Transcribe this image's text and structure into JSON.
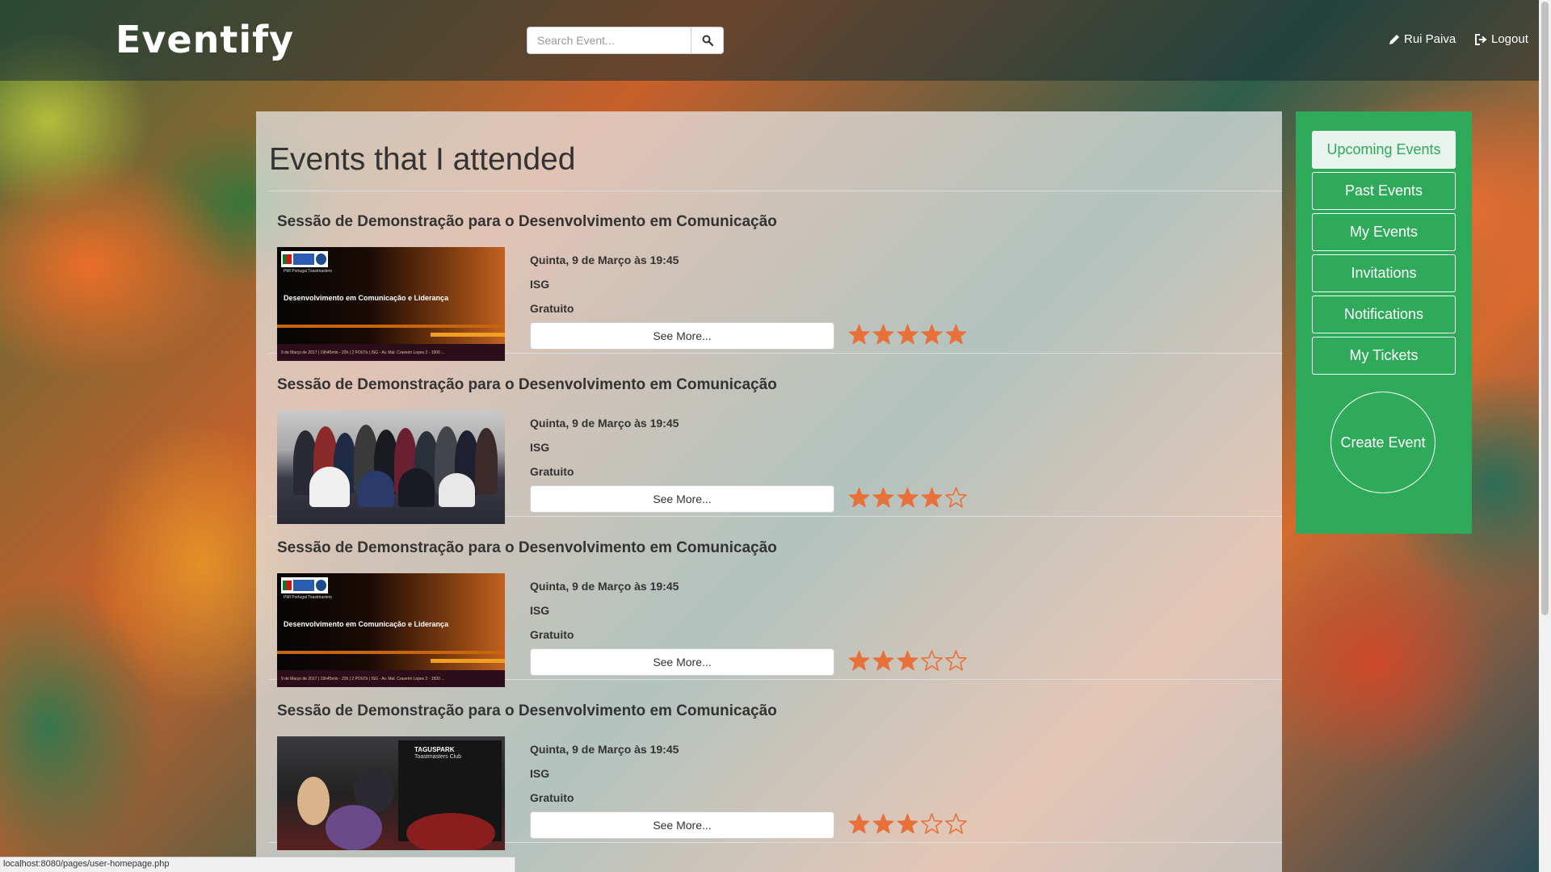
{
  "navbar": {
    "brand": "Eventify",
    "search_placeholder": "Search Event...",
    "user_label": "Rui Paiva",
    "logout_label": "Logout"
  },
  "main": {
    "title": "Events that I attended",
    "events": [
      {
        "title": "Sessão de Demonstração para o Desenvolvimento em Comunicação",
        "date": "Quinta, 9 de Março às 19:45",
        "place": "ISG",
        "price": "Gratuito",
        "see_more_label": "See More...",
        "rating": 5,
        "image": {
          "sub": "PMI Portugal Toastmasters",
          "headline": "Desenvolvimento em Comunicação e Liderança",
          "footer": "9 de Março de 2017 | 19h45min - 22h | 2 POUTs | ISG - Av. Mal. Craveiro Lopes 2 - 1500 ..."
        }
      },
      {
        "title": "Sessão de Demonstração para o Desenvolvimento em Comunicação",
        "date": "Quinta, 9 de Março às 19:45",
        "place": "ISG",
        "price": "Gratuito",
        "see_more_label": "See More...",
        "rating": 4
      },
      {
        "title": "Sessão de Demonstração para o Desenvolvimento em Comunicação",
        "date": "Quinta, 9 de Março às 19:45",
        "place": "ISG",
        "price": "Gratuito",
        "see_more_label": "See More...",
        "rating": 3,
        "image": {
          "sub": "PMI Portugal Toastmasters",
          "headline": "Desenvolvimento em Comunicação e Liderança",
          "footer": "9 de Março de 2017 | 19h45min - 22h | 2 POUTs | ISG - Av. Mal. Craveiro Lopes 2 - 1500 ..."
        }
      },
      {
        "title": "Sessão de Demonstração para o Desenvolvimento em Comunicação",
        "date": "Quinta, 9 de Março às 19:45",
        "place": "ISG",
        "price": "Gratuito",
        "see_more_label": "See More...",
        "rating": 3,
        "image": {
          "title": "TAGUSPARK",
          "sub": "Toastmasters Club"
        }
      }
    ]
  },
  "sidebar": {
    "items": [
      {
        "label": "Upcoming Events",
        "active": true
      },
      {
        "label": "Past Events",
        "active": false
      },
      {
        "label": "My Events",
        "active": false
      },
      {
        "label": "Invitations",
        "active": false
      },
      {
        "label": "Notifications",
        "active": false
      },
      {
        "label": "My Tickets",
        "active": false
      }
    ],
    "create_label": "Create Event"
  },
  "statusbar": {
    "url": "localhost:8080/pages/user-homepage.php"
  },
  "colors": {
    "accent_green": "#2faa5a",
    "star_orange": "#e8703a"
  }
}
